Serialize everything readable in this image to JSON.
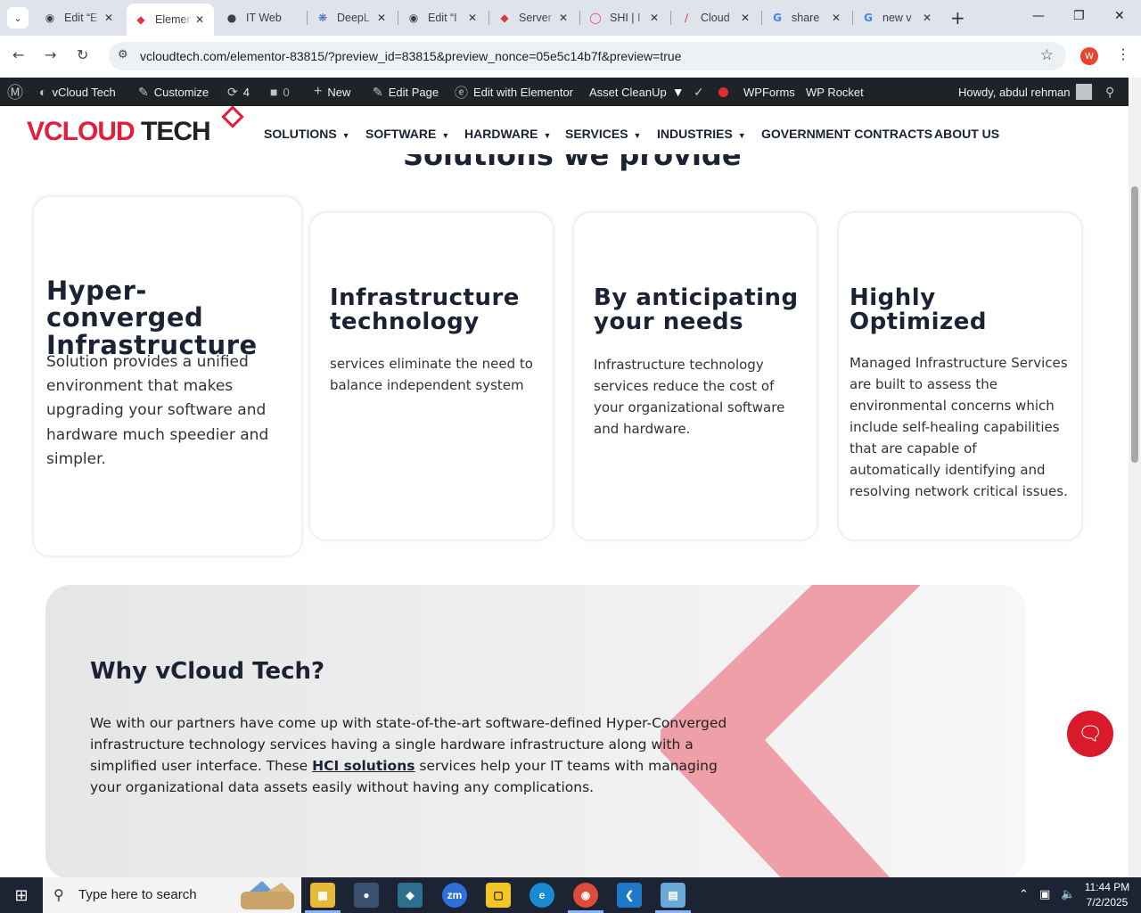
{
  "browser": {
    "tabs": [
      {
        "title": "Edit “E",
        "favicon": "wordpress-icon"
      },
      {
        "title": "Elementor",
        "favicon": "elementor-icon",
        "active": true
      },
      {
        "title": "IT Web",
        "favicon": "github-icon"
      },
      {
        "title": "DeepL",
        "favicon": "deepl-icon"
      },
      {
        "title": "Edit “I",
        "favicon": "wordpress-icon"
      },
      {
        "title": "Server",
        "favicon": "vcloud-icon"
      },
      {
        "title": "SHI | I",
        "favicon": "shi-icon"
      },
      {
        "title": "Cloud",
        "favicon": "cloud-icon"
      },
      {
        "title": "share",
        "favicon": "google-icon"
      },
      {
        "title": "new v",
        "favicon": "google-icon"
      }
    ],
    "url": "vcloudtech.com/elementor-83815/?preview_id=83815&preview_nonce=05e5c14b7f&preview=true",
    "profile_initial": "W"
  },
  "adminbar": {
    "site_name": "vCloud Tech",
    "customize": "Customize",
    "updates_count": "4",
    "comments_count": "0",
    "new": "New",
    "edit_page": "Edit Page",
    "edit_elementor": "Edit with Elementor",
    "asset_cleanup": "Asset CleanUp",
    "wpforms": "WPForms",
    "wp_rocket": "WP Rocket",
    "howdy": "Howdy, abdul rehman"
  },
  "site": {
    "logo_v": "V",
    "logo_cloud": "CLOUD",
    "logo_tech": " TECH",
    "nav": [
      "SOLUTIONS",
      "SOFTWARE",
      "HARDWARE",
      "SERVICES",
      "INDUSTRIES",
      "GOVERNMENT CONTRACTS",
      "ABOUT US"
    ],
    "section_heading": "Solutions we provide",
    "cards": [
      {
        "title": "Hyper-converged Infrastructure",
        "text": "Solution provides a unified environment that makes upgrading your software and hardware much speedier and simpler."
      },
      {
        "title": "Infrastructure technology",
        "text": "services eliminate the need to balance independent system"
      },
      {
        "title": "By anticipating your needs",
        "text": "Infrastructure technology services reduce the cost of your organizational software and hardware."
      },
      {
        "title": "Highly Optimized",
        "text": "Managed Infrastructure Services are built to assess the environmental concerns which include self-healing capabilities that are capable of automatically identifying and resolving network critical issues."
      }
    ],
    "why": {
      "title": "Why vCloud Tech?",
      "text_before": "We with our partners have come up with state-of-the-art software-defined Hyper-Converged infrastructure technology services having a single hardware infrastructure along with a simplified user interface. These ",
      "link": "HCI solutions",
      "text_after": " services help your IT teams with managing your organizational data assets easily without having any complications."
    }
  },
  "taskbar": {
    "search_placeholder": "Type here to search",
    "time": "11:44 PM",
    "date": "7/2/2025"
  }
}
